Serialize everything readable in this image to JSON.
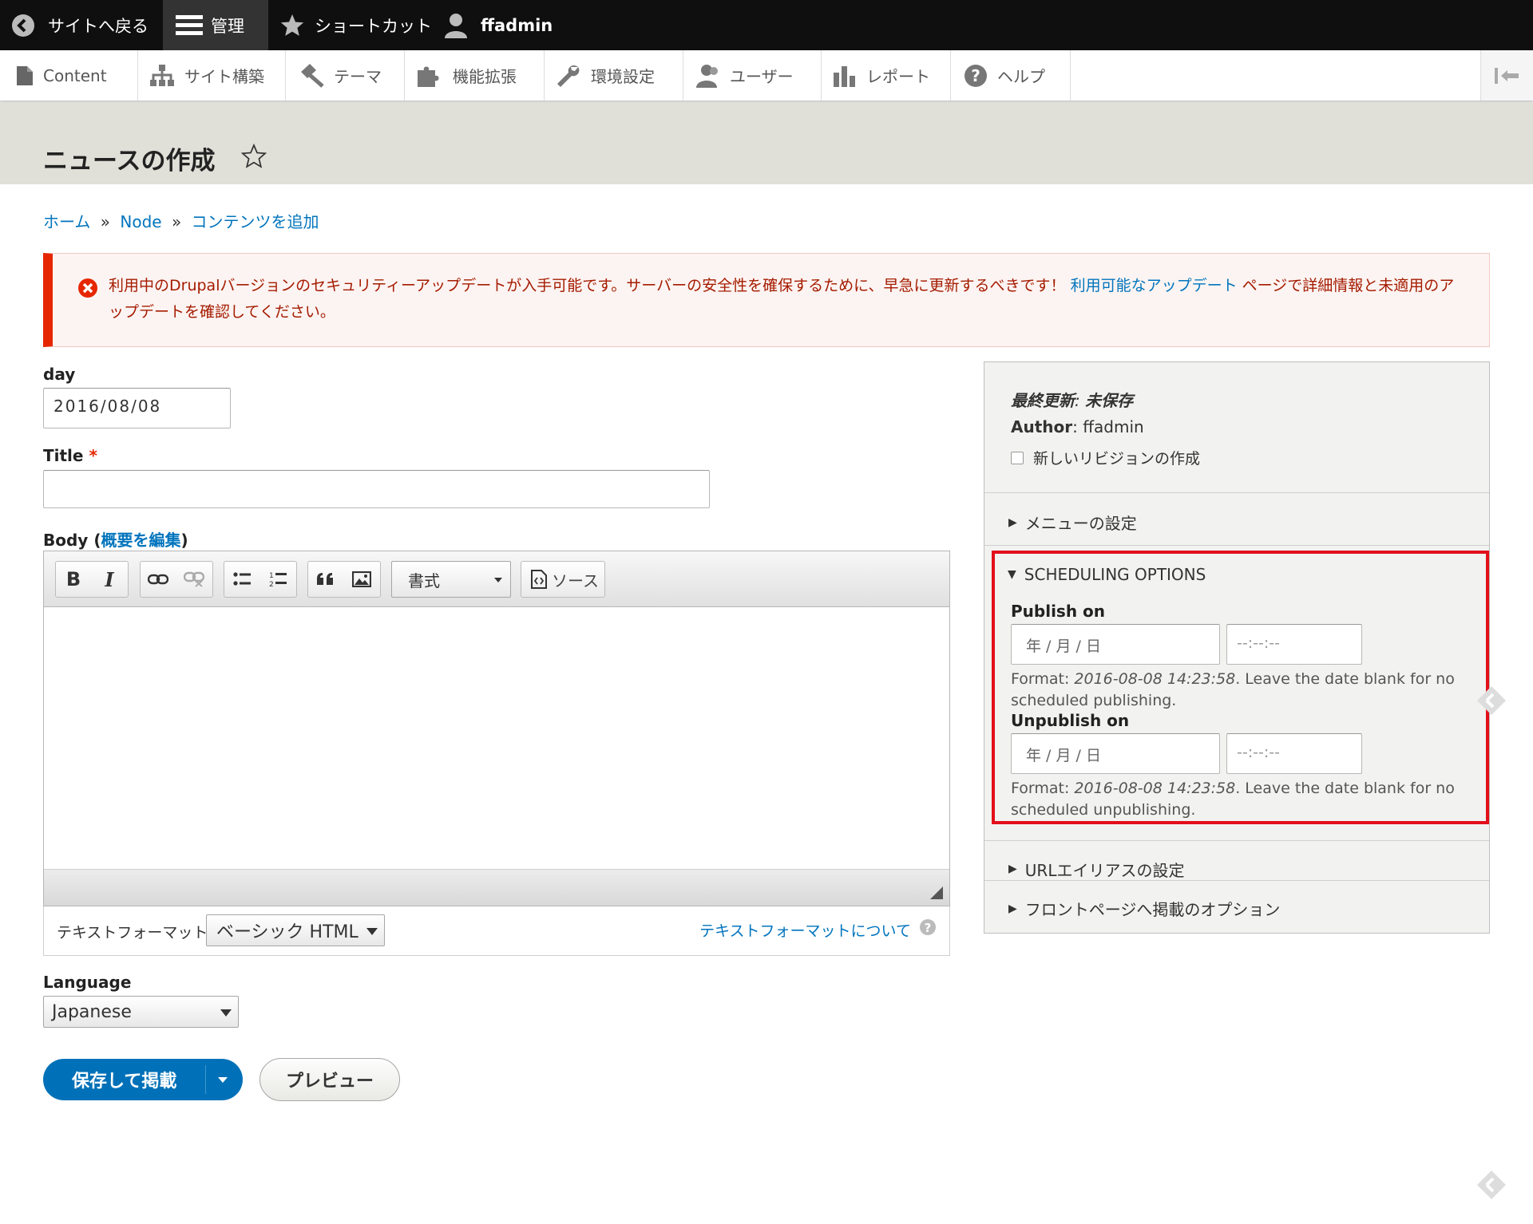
{
  "toolbar": {
    "back": "サイトへ戻る",
    "manage": "管理",
    "shortcuts": "ショートカット",
    "user": "ffadmin"
  },
  "tray": {
    "content": "Content",
    "structure": "サイト構築",
    "theme": "テーマ",
    "extend": "機能拡張",
    "config": "環境設定",
    "people": "ユーザー",
    "reports": "レポート",
    "help": "ヘルプ"
  },
  "page": {
    "title": "ニュースの作成"
  },
  "breadcrumb": {
    "home": "ホーム",
    "sep": "»",
    "node": "Node",
    "add": "コンテンツを追加"
  },
  "message": {
    "text_before": "利用中のDrupalバージョンのセキュリティーアップデートが入手可能です。サーバーの安全性を確保するために、早急に更新するべきです！ ",
    "link": "利用可能なアップデート",
    "text_after": " ページで詳細情報と未適用のアップデートを確認してください。"
  },
  "form": {
    "day_label": "day",
    "day_value": "2016/08/08",
    "title_label": "Title",
    "required_mark": "*",
    "body_label": "Body",
    "body_summary_open": "(",
    "body_summary_link": "概要を編集",
    "body_summary_close": ")",
    "editor": {
      "bold": "B",
      "italic": "I",
      "format_select": "書式",
      "source": "ソース"
    },
    "text_format_label": "テキストフォーマット",
    "text_format_value": "ベーシック HTML",
    "text_format_help": "テキストフォーマットについて",
    "language_label": "Language",
    "language_value": "Japanese",
    "save_button": "保存して掲載",
    "preview_button": "プレビュー"
  },
  "sidebar": {
    "last_saved_label": "最終更新",
    "last_saved_value": "未保存",
    "author_label": "Author",
    "author_value": "ffadmin",
    "new_revision": "新しいリビジョンの作成",
    "menu_settings": "メニューの設定",
    "scheduling_title": "SCHEDULING OPTIONS",
    "publish_on": "Publish on",
    "unpublish_on": "Unpublish on",
    "date_placeholder": "年 / 月 / 日",
    "time_placeholder": "--:--:--",
    "format_label": "Format: ",
    "format_example": "2016-08-08 14:23:58",
    "publish_help_rest": ". Leave the date blank for no scheduled publishing.",
    "unpublish_help_rest": ". Leave the date blank for no scheduled unpublishing.",
    "url_alias": "URLエイリアスの設定",
    "promotion": "フロントページへ掲載のオプション"
  },
  "colors": {
    "accent": "#0074bd",
    "primary_button": "#0071b8",
    "error": "#e62600",
    "highlight_box": "#e2101b"
  }
}
